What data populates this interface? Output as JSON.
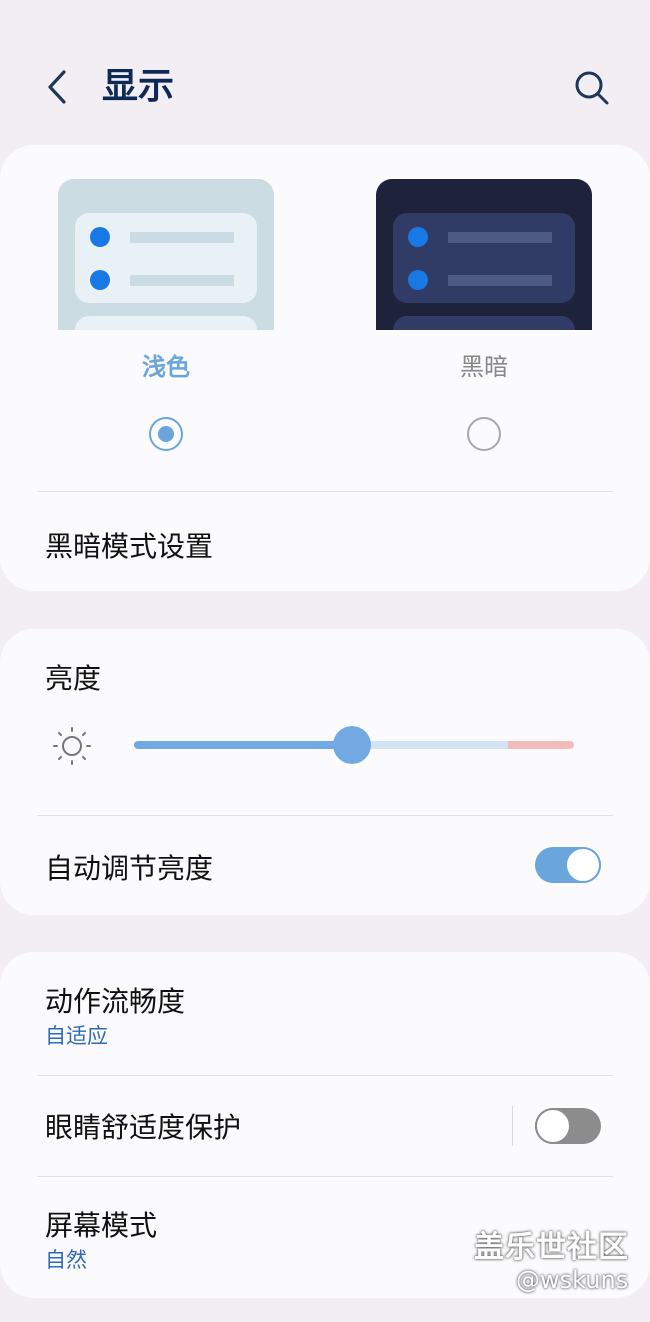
{
  "header": {
    "back_icon": "chevron-left-icon",
    "title": "显示",
    "search_icon": "search-icon"
  },
  "theme": {
    "light_label": "浅色",
    "dark_label": "黑暗",
    "selected": "light",
    "accent_color": "#6aa5dc"
  },
  "dark_mode_settings_label": "黑暗模式设置",
  "brightness": {
    "label": "亮度",
    "icon": "sun-icon",
    "level_fraction": 0.495,
    "auto_label": "自动调节亮度",
    "auto_enabled": true
  },
  "motion_smoothness": {
    "label": "动作流畅度",
    "value": "自适应"
  },
  "eye_comfort": {
    "label": "眼睛舒适度保护",
    "enabled": false
  },
  "screen_mode": {
    "label": "屏幕模式",
    "value": "自然"
  },
  "watermark": {
    "line1": "盖乐世社区",
    "line2": "@wskuns"
  }
}
